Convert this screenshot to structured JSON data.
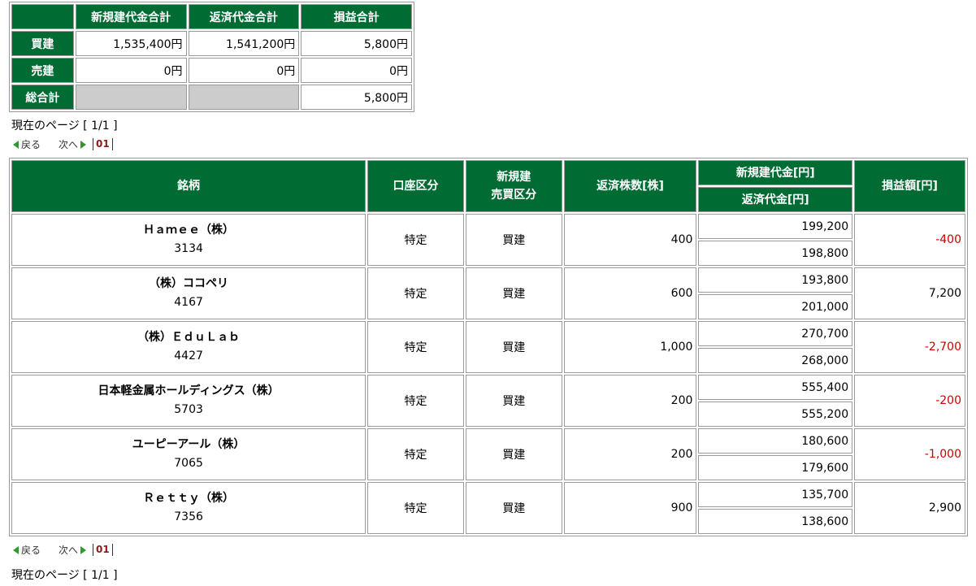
{
  "summary": {
    "headers": [
      "新規建代金合計",
      "返済代金合計",
      "損益合計"
    ],
    "rows": [
      {
        "label": "買建",
        "new": "1,535,400円",
        "close": "1,541,200円",
        "pl": "5,800円"
      },
      {
        "label": "売建",
        "new": "0円",
        "close": "0円",
        "pl": "0円"
      }
    ],
    "total": {
      "label": "総合計",
      "pl": "5,800円"
    }
  },
  "page_info": "現在のページ [ 1/1 ]",
  "pager": {
    "prev": "戻る",
    "next": "次へ",
    "page": "01"
  },
  "table": {
    "headers": {
      "stock": "銘柄",
      "account": "口座区分",
      "trade_type_1": "新規建",
      "trade_type_2": "売買区分",
      "qty": "返済株数[株]",
      "new_amount": "新規建代金[円]",
      "close_amount": "返済代金[円]",
      "pl": "損益額[円]"
    },
    "rows": [
      {
        "name": "Ｈａｍｅｅ（株）",
        "code": "3134",
        "account": "特定",
        "type": "買建",
        "qty": "400",
        "new": "199,200",
        "close": "198,800",
        "pl": "-400",
        "negative": true
      },
      {
        "name": "（株）ココペリ",
        "code": "4167",
        "account": "特定",
        "type": "買建",
        "qty": "600",
        "new": "193,800",
        "close": "201,000",
        "pl": "7,200",
        "negative": false
      },
      {
        "name": "（株）ＥｄｕＬａｂ",
        "code": "4427",
        "account": "特定",
        "type": "買建",
        "qty": "1,000",
        "new": "270,700",
        "close": "268,000",
        "pl": "-2,700",
        "negative": true
      },
      {
        "name": "日本軽金属ホールディングス（株）",
        "code": "5703",
        "account": "特定",
        "type": "買建",
        "qty": "200",
        "new": "555,400",
        "close": "555,200",
        "pl": "-200",
        "negative": true
      },
      {
        "name": "ユーピーアール（株）",
        "code": "7065",
        "account": "特定",
        "type": "買建",
        "qty": "200",
        "new": "180,600",
        "close": "179,600",
        "pl": "-1,000",
        "negative": true
      },
      {
        "name": "Ｒｅｔｔｙ（株）",
        "code": "7356",
        "account": "特定",
        "type": "買建",
        "qty": "900",
        "new": "135,700",
        "close": "138,600",
        "pl": "2,900",
        "negative": false
      }
    ]
  },
  "colors": {
    "header_green": "#006b33",
    "negative_red": "#cc0000",
    "pager_green": "#2e9a2e",
    "page_link": "#8b1a1a"
  }
}
